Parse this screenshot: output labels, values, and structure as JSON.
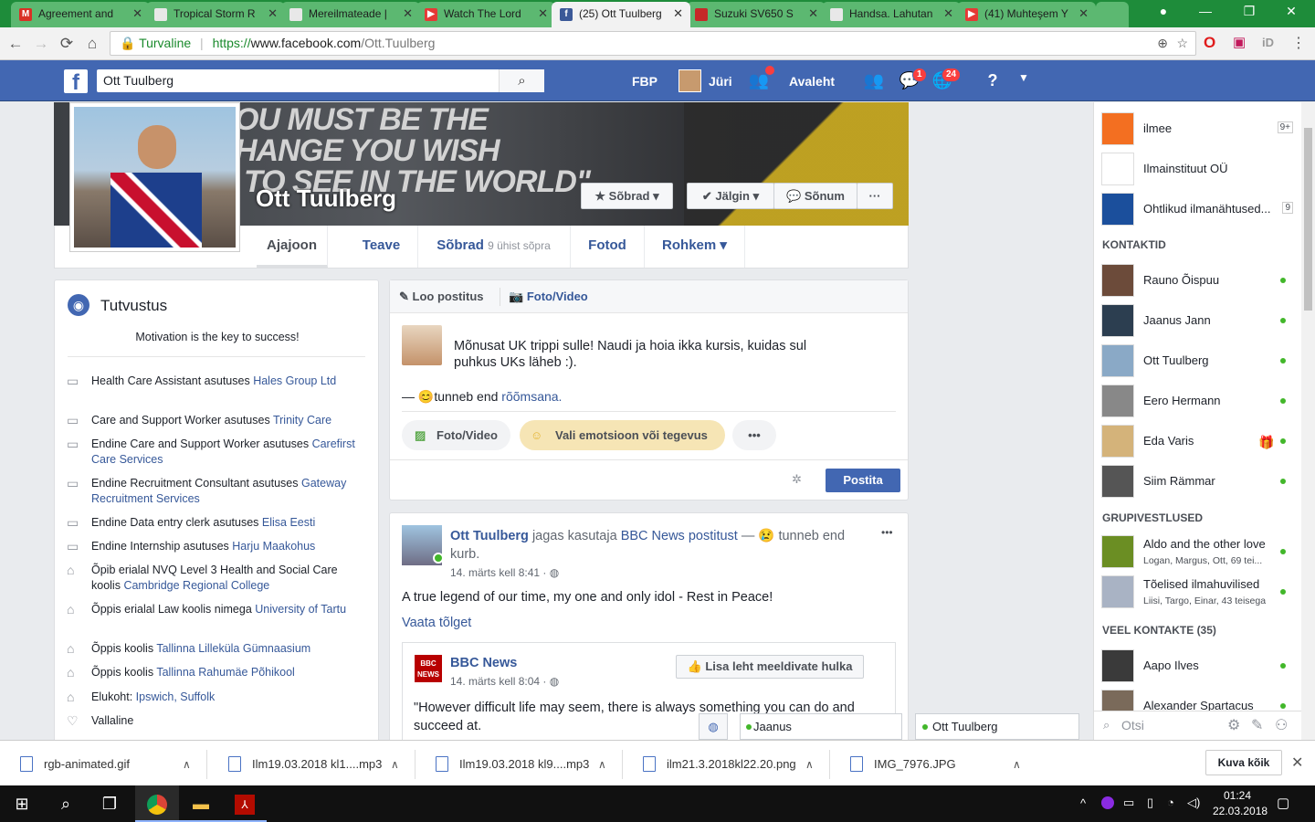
{
  "browser": {
    "tabs": [
      {
        "label": "Agreement and",
        "fav_color": "#d93025",
        "fav_letter": "M"
      },
      {
        "label": "Tropical Storm R",
        "fav_color": "#e8e8e8",
        "fav_letter": ""
      },
      {
        "label": "Mereilmateade |",
        "fav_color": "#e8e8e8",
        "fav_letter": ""
      },
      {
        "label": "Watch The Lord",
        "fav_color": "#e53935",
        "fav_letter": "▶"
      },
      {
        "label": "(25) Ott Tuulberg",
        "fav_color": "#3b5998",
        "fav_letter": "f"
      },
      {
        "label": "Suzuki SV650 S",
        "fav_color": "#c62828",
        "fav_letter": ""
      },
      {
        "label": "Handsa. Lahutan",
        "fav_color": "#e8e8e8",
        "fav_letter": ""
      },
      {
        "label": "(41) Muhteşem Y",
        "fav_color": "#e53935",
        "fav_letter": "▶"
      }
    ],
    "url_secure": "Turvaline",
    "url_scheme": "https://",
    "url_host": "www.facebook.com",
    "url_path": "/Ott.Tuulberg",
    "ext_label": "iD"
  },
  "fb": {
    "search_value": "Ott Tuulberg",
    "nav_fbp": "FBP",
    "nav_user": "Jüri",
    "nav_home": "Avaleht",
    "badge_messages": "1",
    "badge_notifications": "24"
  },
  "profile": {
    "name": "Ott Tuulberg",
    "cover_lines": [
      "OU MUST  BE THE",
      "HANGE  YOU WISH",
      "TO SEE  IN THE WORLD\""
    ],
    "btn_friends": "Sõbrad",
    "btn_follow": "Jälgin",
    "btn_message": "Sõnum",
    "btn_more": "···",
    "tabs": [
      {
        "label": "Ajajoon",
        "sub": ""
      },
      {
        "label": "Teave",
        "sub": ""
      },
      {
        "label": "Sõbrad",
        "sub": "9 ühist sõpra"
      },
      {
        "label": "Fotod",
        "sub": ""
      },
      {
        "label": "Rohkem ▾",
        "sub": ""
      }
    ]
  },
  "intro": {
    "title": "Tutvustus",
    "bio": "Motivation is the key to success!",
    "items": [
      {
        "icon": "briefcase-icon",
        "text": "Health Care Assistant asutuses ",
        "link": "Hales Group Ltd"
      },
      {
        "icon": "briefcase-icon",
        "text": "Care and Support Worker asutuses ",
        "link": "Trinity Care"
      },
      {
        "icon": "briefcase-icon",
        "text": "Endine Care and Support Worker asutuses ",
        "link": "Carefirst Care Services"
      },
      {
        "icon": "briefcase-icon",
        "text": "Endine Recruitment Consultant asutuses ",
        "link": "Gateway Recruitment Services"
      },
      {
        "icon": "briefcase-icon",
        "text": "Endine Data entry clerk asutuses ",
        "link": "Elisa Eesti"
      },
      {
        "icon": "briefcase-icon",
        "text": "Endine Internship asutuses ",
        "link": "Harju Maakohus"
      },
      {
        "icon": "graduation-cap-icon",
        "text": "Õpib erialal NVQ Level 3 Health and Social Care koolis ",
        "link": "Cambridge Regional College"
      },
      {
        "icon": "graduation-cap-icon",
        "text": "Õppis erialal Law koolis nimega ",
        "link": "University of Tartu"
      },
      {
        "icon": "graduation-cap-icon",
        "text": "Õppis koolis ",
        "link": "Tallinna Lilleküla Gümnaasium"
      },
      {
        "icon": "graduation-cap-icon",
        "text": "Õppis koolis ",
        "link": "Tallinna Rahumäe Põhikool"
      },
      {
        "icon": "home-icon",
        "text": "Elukoht: ",
        "link": "Ipswich, Suffolk"
      },
      {
        "icon": "heart-icon",
        "text": "Vallaline",
        "link": ""
      }
    ]
  },
  "composer": {
    "tab_create": "Loo postitus",
    "tab_photo": "Foto/Video",
    "text_line1": "Mõnusat UK trippi sulle! Naudi ja hoia ikka kursis, kuidas sul",
    "text_line2": "puhkus UKs läheb :).",
    "feeling_prefix": "— ",
    "feeling_text": "tunneb end ",
    "feeling_link": "rõõmsana.",
    "pill_photo": "Foto/Video",
    "pill_feeling": "Vali emotsioon või tegevus",
    "pill_more": "•••",
    "post_btn": "Postita"
  },
  "post": {
    "author": "Ott Tuulberg",
    "shared": " jagas kasutaja ",
    "shared_link": "BBC News postitust",
    "feeling": " — 😢 tunneb end",
    "feeling2": "kurb.",
    "time": "14. märts kell 8:41 · ",
    "text": "A true legend of our time, my one and only idol - Rest in Peace!",
    "see_translation": "Vaata tõlget",
    "menu": "•••",
    "shared_author": "BBC News",
    "shared_time": "14. märts kell 8:04 · ",
    "like_page": "Lisa leht meeldivate hulka",
    "quote": "\"However difficult life may seem, there is always something you can do and succeed at."
  },
  "sidebar": {
    "pages": [
      {
        "name": "ilmee",
        "count": "9+",
        "color": "#f36f21"
      },
      {
        "name": "Ilmainstituut OÜ",
        "count": "",
        "color": "#ffffff"
      },
      {
        "name": "Ohtlikud ilmanähtused...",
        "count": "9",
        "color": "#1b4f9c"
      }
    ],
    "contacts_head": "KONTAKTID",
    "contacts": [
      {
        "name": "Rauno Õispuu",
        "color": "#6c4b3a"
      },
      {
        "name": "Jaanus Jann",
        "color": "#2c3e50"
      },
      {
        "name": "Ott Tuulberg",
        "color": "#8aa9c6"
      },
      {
        "name": "Eero Hermann",
        "color": "#888888"
      },
      {
        "name": "Eda Varis",
        "color": "#d4b37a"
      },
      {
        "name": "Siim Rämmar",
        "color": "#555555"
      }
    ],
    "groups_head": "GRUPIVESTLUSED",
    "groups": [
      {
        "name": "Aldo and the other love",
        "sub": "Logan, Margus, Ott, 69 tei...",
        "color": "#6b8e23"
      },
      {
        "name": "Tõelised ilmahuvilised",
        "sub": "Liisi, Targo, Einar, 43 teisega",
        "color": "#a9b3c4"
      }
    ],
    "more_head": "VEEL KONTAKTE (35)",
    "more": [
      {
        "name": "Aapo Ilves",
        "color": "#3a3a3a"
      },
      {
        "name": "Alexander Spartacus",
        "color": "#7a6a5a"
      }
    ],
    "search_placeholder": "Otsi"
  },
  "chat": {
    "tab1": "Jaanus",
    "tab2": "Ott Tuulberg"
  },
  "downloads": {
    "items": [
      "rgb-animated.gif",
      "Ilm19.03.2018 kl1....mp3",
      "Ilm19.03.2018 kl9....mp3",
      "ilm21.3.2018kl22.20.png",
      "IMG_7976.JPG"
    ],
    "show_all": "Kuva kõik"
  },
  "taskbar": {
    "time": "01:24",
    "date": "22.03.2018"
  }
}
